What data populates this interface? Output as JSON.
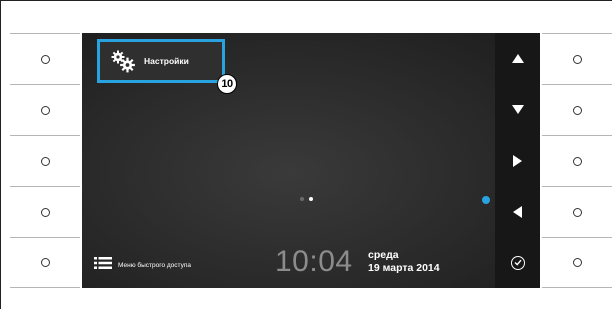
{
  "tile": {
    "label": "Настройки",
    "icon": "gears-icon",
    "accent": "#29a3e0"
  },
  "callout": {
    "number": "10"
  },
  "quick_menu": {
    "label": "Меню быстрого доступа",
    "icon": "list-icon"
  },
  "clock": {
    "time": "10:04"
  },
  "date": {
    "weekday": "среда",
    "date": "19 марта 2014"
  },
  "pager": {
    "pages": 2,
    "current": 2
  },
  "nav": [
    "up-arrow-icon",
    "down-arrow-icon",
    "right-arrow-icon",
    "left-arrow-icon",
    "check-icon"
  ],
  "softkeys": {
    "count_per_side": 5
  }
}
